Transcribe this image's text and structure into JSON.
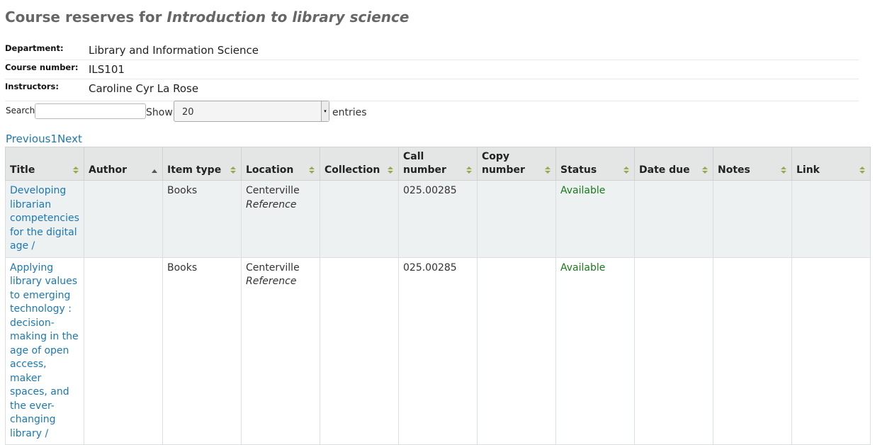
{
  "page": {
    "title_prefix": "Course reserves for ",
    "course_title": "Introduction to library science"
  },
  "details": {
    "department_label": "Department:",
    "department_value": "Library and Information Science",
    "course_number_label": "Course number:",
    "course_number_value": "ILS101",
    "instructors_label": "Instructors:",
    "instructors_value": "Caroline Cyr La Rose"
  },
  "controls": {
    "search_label": "Search:",
    "search_value": "",
    "show_label": "Show",
    "page_size": "20",
    "entries_label": "entries"
  },
  "pager": {
    "previous": "Previous",
    "current": "1",
    "next": "Next"
  },
  "table": {
    "columns": [
      "Title",
      "Author",
      "Item type",
      "Location",
      "Collection",
      "Call number",
      "Copy number",
      "Status",
      "Date due",
      "Notes",
      "Link"
    ],
    "sort": {
      "column": "Author",
      "direction": "ascending"
    },
    "colors": {
      "link": "#1b78b3",
      "available": "#1a7a1a",
      "header_bg": "#e4e6e6",
      "odd_row_bg": "#eef1f1"
    },
    "rows": [
      {
        "title": "Developing librarian competencies for the digital age /",
        "author": "",
        "item_type": "Books",
        "location": "Centerville",
        "sublocation": "Reference",
        "collection": "",
        "call_number": "025.00285",
        "copy_number": "",
        "status": "Available",
        "date_due": "",
        "notes": "",
        "link": ""
      },
      {
        "title": "Applying library values to emerging technology : decision-making in the age of open access, maker spaces, and the ever-changing library /",
        "author": "",
        "item_type": "Books",
        "location": "Centerville",
        "sublocation": "Reference",
        "collection": "",
        "call_number": "025.00285",
        "copy_number": "",
        "status": "Available",
        "date_due": "",
        "notes": "",
        "link": ""
      }
    ]
  }
}
